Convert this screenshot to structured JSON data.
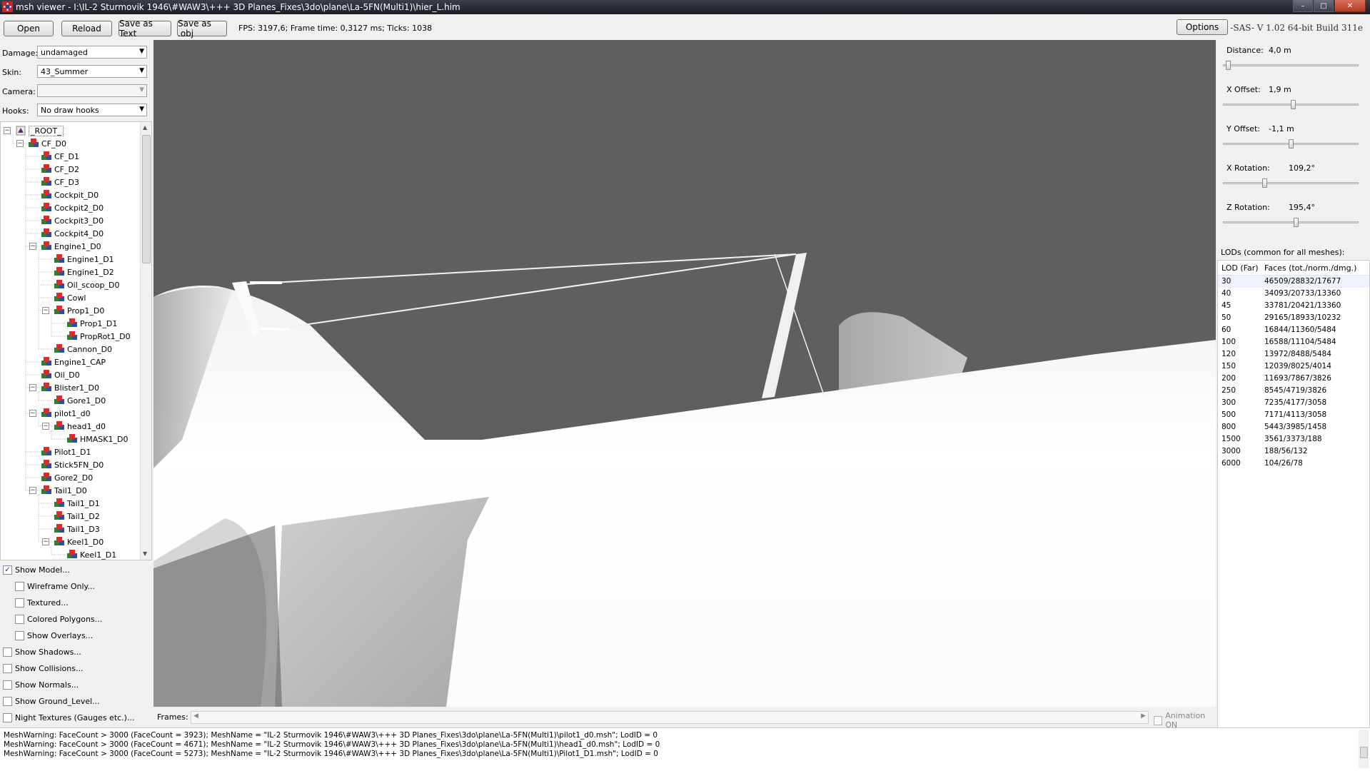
{
  "window": {
    "title": "msh viewer - I:\\IL-2 Sturmovik 1946\\#WAW3\\+++ 3D Planes_Fixes\\3do\\plane\\La-5FN(Multi1)\\hier_L.him"
  },
  "toolbar": {
    "open": "Open",
    "reload": "Reload",
    "save_text": "Save as Text",
    "save_obj": "Save as .obj",
    "fps": "FPS: 3197,6; Frame time: 0,3127 ms; Ticks: 1038",
    "options": "Options",
    "version": "-SAS- V 1.02  64-bit  Build 311e"
  },
  "left": {
    "damage_label": "Damage:",
    "damage_value": "undamaged",
    "skin_label": "Skin:",
    "skin_value": "43_Summer",
    "camera_label": "Camera:",
    "camera_value": "",
    "hooks_label": "Hooks:",
    "hooks_value": "No draw hooks"
  },
  "tree": [
    {
      "label": "_ROOT_",
      "level": 0,
      "expander": "minus",
      "root": true
    },
    {
      "label": "CF_D0",
      "level": 1,
      "expander": "minus"
    },
    {
      "label": "CF_D1",
      "level": 2
    },
    {
      "label": "CF_D2",
      "level": 2
    },
    {
      "label": "CF_D3",
      "level": 2
    },
    {
      "label": "Cockpit_D0",
      "level": 2
    },
    {
      "label": "Cockpit2_D0",
      "level": 2
    },
    {
      "label": "Cockpit3_D0",
      "level": 2
    },
    {
      "label": "Cockpit4_D0",
      "level": 2
    },
    {
      "label": "Engine1_D0",
      "level": 2,
      "expander": "minus"
    },
    {
      "label": "Engine1_D1",
      "level": 3
    },
    {
      "label": "Engine1_D2",
      "level": 3
    },
    {
      "label": "Oil_scoop_D0",
      "level": 3
    },
    {
      "label": "Cowl",
      "level": 3
    },
    {
      "label": "Prop1_D0",
      "level": 3,
      "expander": "minus"
    },
    {
      "label": "Prop1_D1",
      "level": 4
    },
    {
      "label": "PropRot1_D0",
      "level": 4
    },
    {
      "label": "Cannon_D0",
      "level": 3
    },
    {
      "label": "Engine1_CAP",
      "level": 2
    },
    {
      "label": "Oil_D0",
      "level": 2
    },
    {
      "label": "Blister1_D0",
      "level": 2,
      "expander": "minus"
    },
    {
      "label": "Gore1_D0",
      "level": 3
    },
    {
      "label": "pilot1_d0",
      "level": 2,
      "expander": "minus"
    },
    {
      "label": "head1_d0",
      "level": 3,
      "expander": "minus"
    },
    {
      "label": "HMASK1_D0",
      "level": 4
    },
    {
      "label": "Pilot1_D1",
      "level": 2
    },
    {
      "label": "Stick5FN_D0",
      "level": 2
    },
    {
      "label": "Gore2_D0",
      "level": 2
    },
    {
      "label": "Tail1_D0",
      "level": 2,
      "expander": "minus"
    },
    {
      "label": "Tail1_D1",
      "level": 3
    },
    {
      "label": "Tail1_D2",
      "level": 3
    },
    {
      "label": "Tail1_D3",
      "level": 3
    },
    {
      "label": "Keel1_D0",
      "level": 3,
      "expander": "minus"
    },
    {
      "label": "Keel1_D1",
      "level": 4
    }
  ],
  "options": [
    {
      "label": "Show Model...",
      "checked": true,
      "indent": 0
    },
    {
      "label": "Wireframe Only...",
      "checked": false,
      "indent": 1
    },
    {
      "label": "Textured...",
      "checked": false,
      "indent": 1
    },
    {
      "label": "Colored Polygons...",
      "checked": false,
      "indent": 1
    },
    {
      "label": "Show Overlays...",
      "checked": false,
      "indent": 1
    },
    {
      "label": "Show Shadows...",
      "checked": false,
      "indent": 0
    },
    {
      "label": "Show Collisions...",
      "checked": false,
      "indent": 0
    },
    {
      "label": "Show Normals...",
      "checked": false,
      "indent": 0
    },
    {
      "label": "Show Ground_Level...",
      "checked": false,
      "indent": 0
    },
    {
      "label": "Night Textures (Gauges etc.)...",
      "checked": false,
      "indent": 0
    }
  ],
  "frames": {
    "label": "Frames:",
    "animation": "Animation ON",
    "animation_checked": false
  },
  "params": [
    {
      "label": "Distance:",
      "value": "4,0 m",
      "level": 0.02
    },
    {
      "label": "X Offset:",
      "value": "1,9 m",
      "level": 0.52
    },
    {
      "label": "Y Offset:",
      "value": "-1,1 m",
      "level": 0.5
    },
    {
      "label": "X Rotation:",
      "value": "109,2°",
      "level": 0.3
    },
    {
      "label": "Z Rotation:",
      "value": "195,4°",
      "level": 0.54
    }
  ],
  "lods": {
    "title": "LODs (common for all meshes):",
    "col_lod": "LOD (Far)",
    "col_faces": "Faces (tot./norm./dmg.)",
    "rows": [
      [
        "30",
        "46509/28832/17677"
      ],
      [
        "40",
        "34093/20733/13360"
      ],
      [
        "45",
        "33781/20421/13360"
      ],
      [
        "50",
        "29165/18933/10232"
      ],
      [
        "60",
        "16844/11360/5484"
      ],
      [
        "100",
        "16588/11104/5484"
      ],
      [
        "120",
        "13972/8488/5484"
      ],
      [
        "150",
        "12039/8025/4014"
      ],
      [
        "200",
        "11693/7867/3826"
      ],
      [
        "250",
        "8545/4719/3826"
      ],
      [
        "300",
        "7235/4177/3058"
      ],
      [
        "500",
        "7171/4113/3058"
      ],
      [
        "800",
        "5443/3985/1458"
      ],
      [
        "1500",
        "3561/3373/188"
      ],
      [
        "3000",
        "188/56/132"
      ],
      [
        "6000",
        "104/26/78"
      ]
    ]
  },
  "log": [
    "MeshWarning: FaceCount > 3000 (FaceCount = 3923); MeshName = \"IL-2 Sturmovik 1946\\#WAW3\\+++ 3D Planes_Fixes\\3do\\plane\\La-5FN(Multi1)\\pilot1_d0.msh\"; LodID = 0",
    "MeshWarning: FaceCount > 3000 (FaceCount = 4671); MeshName = \"IL-2 Sturmovik 1946\\#WAW3\\+++ 3D Planes_Fixes\\3do\\plane\\La-5FN(Multi1)\\head1_d0.msh\"; LodID = 0",
    "MeshWarning: FaceCount > 3000 (FaceCount = 5273); MeshName = \"IL-2 Sturmovik 1946\\#WAW3\\+++ 3D Planes_Fixes\\3do\\plane\\La-5FN(Multi1)\\Pilot1_D1.msh\"; LodID = 0"
  ],
  "colors": {
    "viewport_bg": "#5f5f5f",
    "model": "#f5f5f5",
    "accent": "#1a3a9a"
  }
}
